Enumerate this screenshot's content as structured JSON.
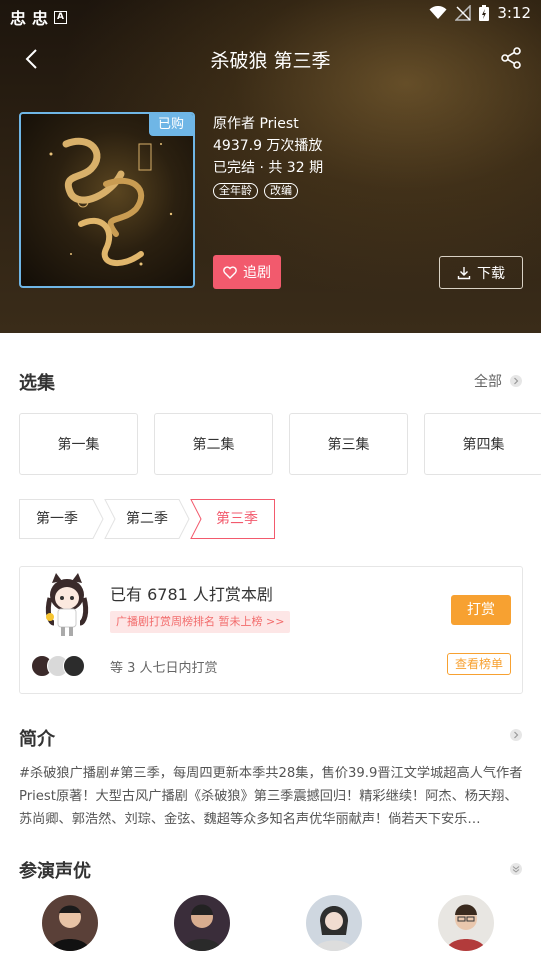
{
  "status_bar": {
    "time": "3:12",
    "left_icons": [
      "qq-icon",
      "qq-icon",
      "a-icon"
    ],
    "right_icons": [
      "wifi-icon",
      "no-signal-icon",
      "battery-icon"
    ]
  },
  "header": {
    "title": "杀破狼 第三季",
    "back_icon": "back-arrow-icon",
    "share_icon": "share-icon"
  },
  "drama": {
    "bought_badge": "已购",
    "author": "原作者 Priest",
    "plays": "4937.9 万次播放",
    "status": "已完结 · 共 32 期",
    "tags": [
      "全年龄",
      "改编"
    ],
    "follow_label": "追剧",
    "download_label": "下载"
  },
  "episodes_section": {
    "title": "选集",
    "all_label": "全部",
    "episodes": [
      "第一集",
      "第二集",
      "第三集",
      "第四集"
    ],
    "seasons": [
      "第一季",
      "第二季",
      "第三季"
    ],
    "active_season_index": 2
  },
  "reward": {
    "count_text": "已有 6781 人打赏本剧",
    "rank_text": "广播剧打赏周榜排名 暂未上榜 >>",
    "tip_label": "打赏",
    "week_text": "等 3 人七日内打赏",
    "rank_button": "查看榜单"
  },
  "intro": {
    "title": "简介",
    "text": "#杀破狼广播剧#第三季，每周四更新本季共28集，售价39.9晋江文学城超高人气作者Priest原著！大型古风广播剧《杀破狼》第三季震撼回归！精彩继续！阿杰、杨天翔、苏尚卿、郭浩然、刘琮、金弦、魏超等众多知名声优华丽献声！倘若天下安乐…"
  },
  "cast": {
    "title": "参演声优"
  },
  "colors": {
    "accent_red": "#f25a6d",
    "accent_orange": "#f7a131",
    "badge_blue": "#6fb6e6"
  }
}
